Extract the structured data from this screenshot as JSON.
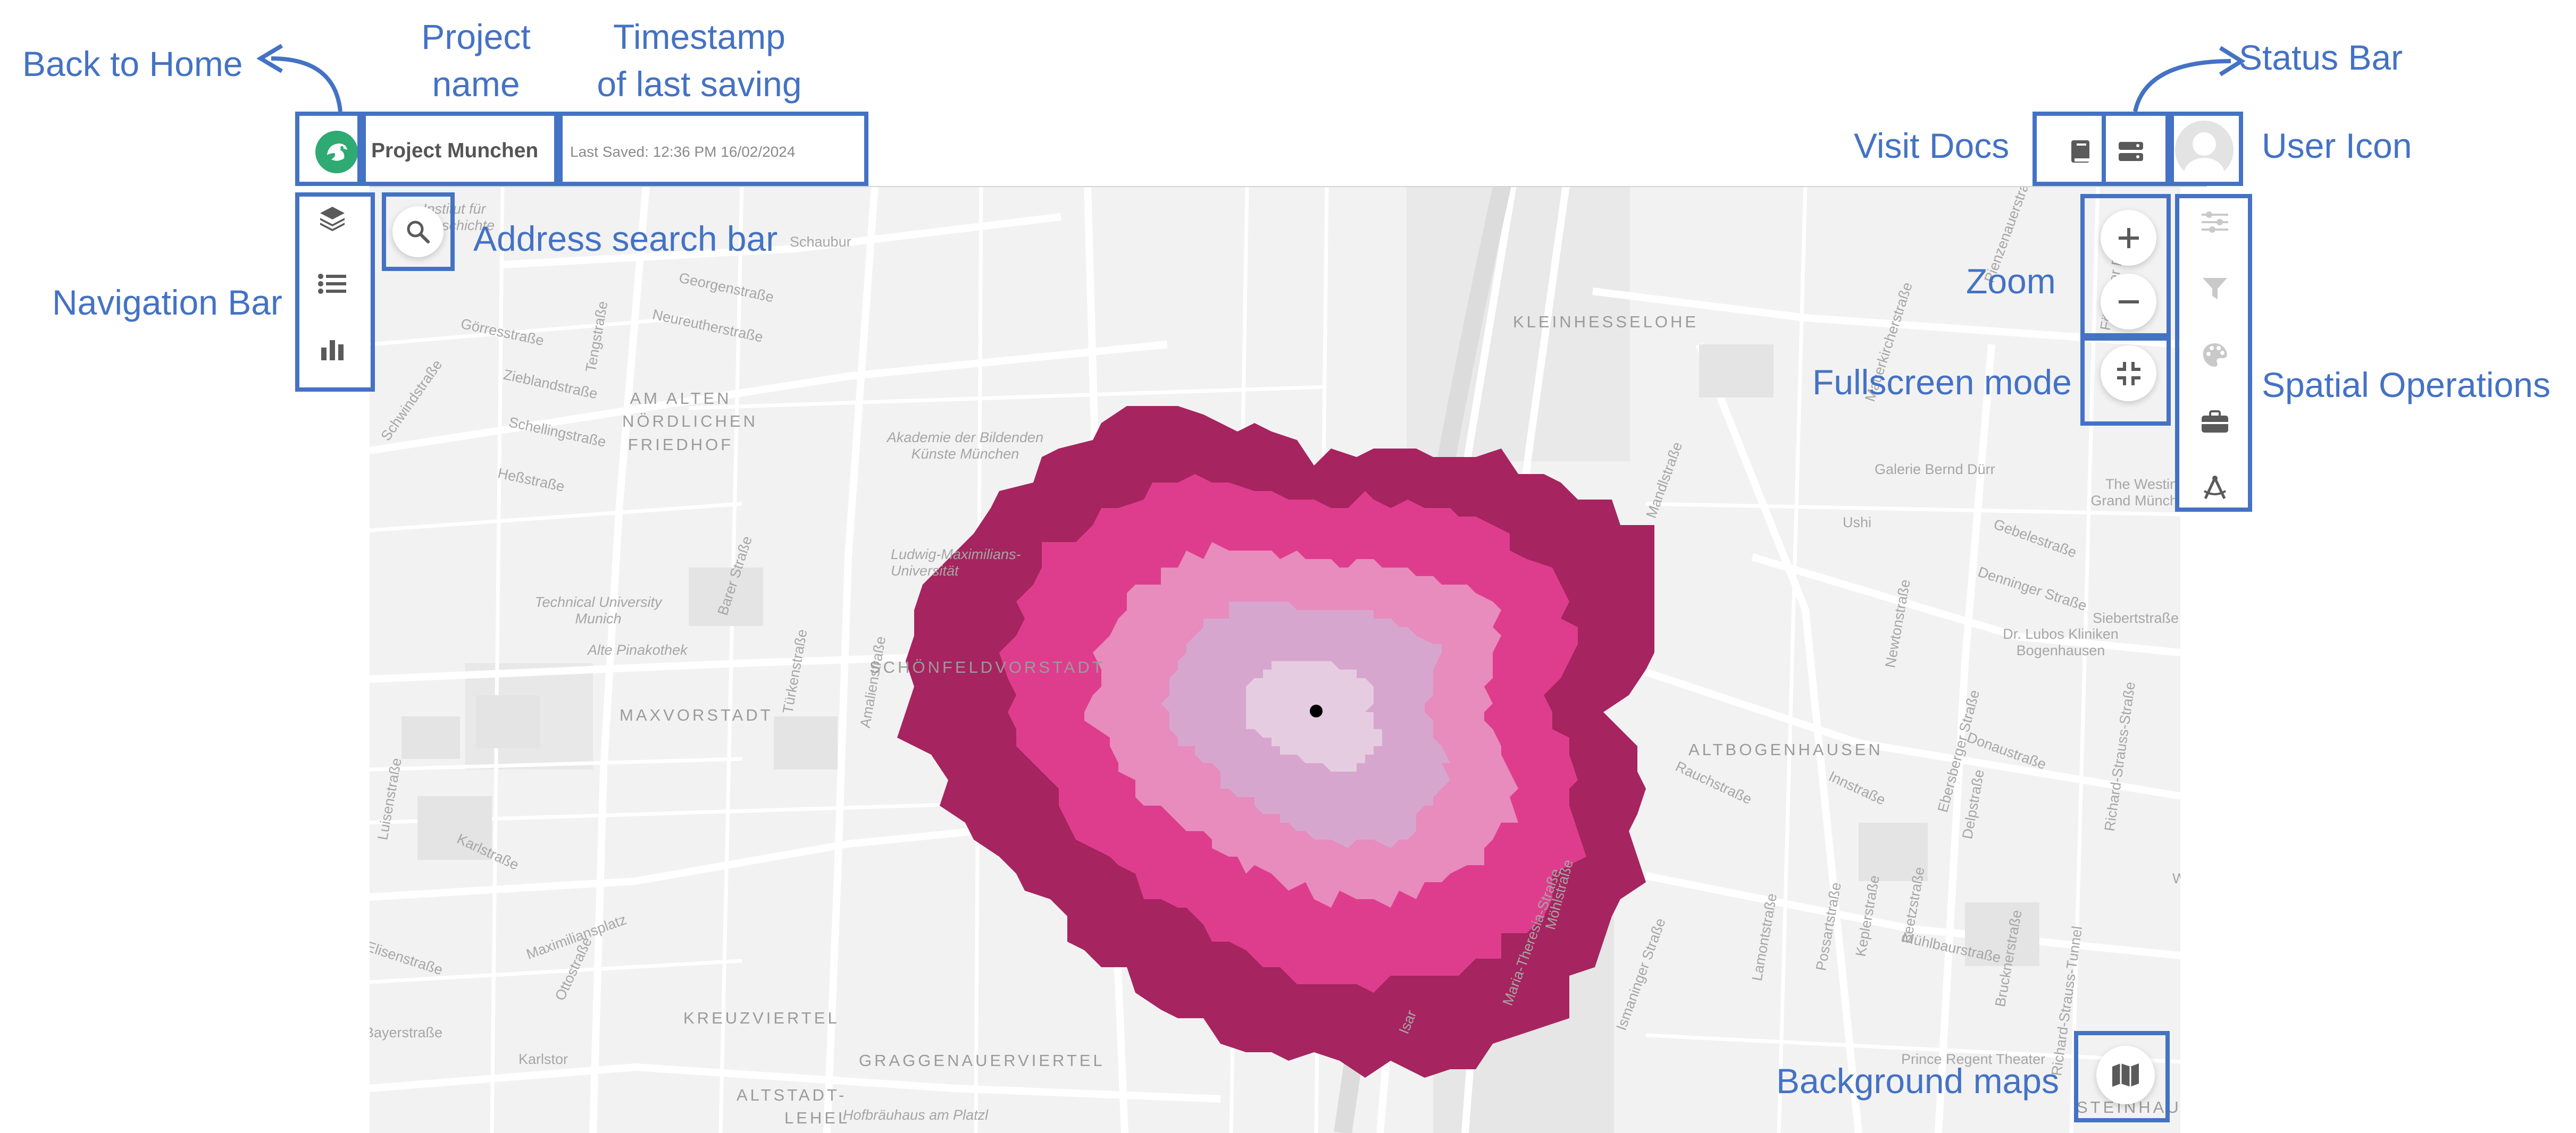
{
  "app": {
    "project_name": "Project Munchen",
    "last_saved": "Last Saved: 12:36 PM 16/02/2024"
  },
  "annotations": {
    "back_home": "Back to Home",
    "project_name_line1": "Project",
    "project_name_line2": "name",
    "timestamp_line1": "Timestamp",
    "timestamp_line2": "of last saving",
    "status_bar": "Status Bar",
    "visit_docs": "Visit Docs",
    "user_icon": "User Icon",
    "navigation_bar": "Navigation Bar",
    "address_search": "Address search bar",
    "zoom": "Zoom",
    "fullscreen": "Fullscreen mode",
    "spatial_operations": "Spatial Operations",
    "background_maps": "Background maps"
  },
  "map": {
    "streets": [
      "Schaubur",
      "Georgenstraße",
      "Neureutherstraße",
      "Görresstraße",
      "Tengstraße",
      "Zieblandstraße",
      "Schellingstraße",
      "Heßstraße",
      "Schwindstraße",
      "Barer Straße",
      "Türkenstraße",
      "Amalienstraße",
      "Luisenstraße",
      "Karlstraße",
      "Maximiliansplatz",
      "Elisenstraße",
      "Ottostraße",
      "Bayerstraße",
      "Karlstor",
      "Hofbräuhaus am Platzl",
      "Maria-Theresia-Straße",
      "Möhlstraße",
      "Ismaninger Straße",
      "Lamontstraße",
      "Possartstraße",
      "Keplerstraße",
      "Beetzstraße",
      "Mühlbaurstraße",
      "Brucknerstraße",
      "Richard-Strauss-Tunnel",
      "Richard-Strauss-Straße",
      "Rauchstraße",
      "Innstraße",
      "Ebersberger Straße",
      "Delpstraße",
      "Donaustraße",
      "Gebelestraße",
      "Denninger Straße",
      "Newtonstraße",
      "Siebertstraße",
      "Ushi",
      "Galerie Bernd Dürr",
      "The Westin Grand Münch",
      "Dr. Lubos Kliniken Bogenhausen",
      "Prince Regent Theater",
      "Mauerkircherstraße",
      "Föhringer Ring",
      "Akademie der Bildenden Künste München",
      "Technical University Munich",
      "Alte Pinakothek",
      "Ludwig-Maximilians-Universität",
      "Mandlstraße",
      "Institut für Geschichte",
      "Isar",
      "Pienzenauerstraße",
      "Wagmüllerstraße"
    ],
    "districts": [
      "AM ALTEN",
      "NÖRDLICHEN",
      "FRIEDHOF",
      "MAXVORSTADT",
      "SCHÖNFELDVORSTADT",
      "KLEINHESSELOHE",
      "ALTBOGENHAUSEN",
      "KREUZVIERTEL",
      "GRAGGENAUERVIERTEL",
      "ALTSTADT-",
      "LEHEL",
      "STEINHAUSEN"
    ]
  },
  "isochrone_colors": [
    "#a6245f",
    "#de3d8d",
    "#e88bbd",
    "#d7a6cf",
    "#e6cce0"
  ],
  "colors": {
    "accent": "#4472c4",
    "logo": "#2eaa72",
    "icon": "#5a5a5a",
    "icon_disabled": "#c9c9c9"
  },
  "icons": {
    "logo": "logo-icon",
    "docs": "book-icon",
    "status": "server-icon",
    "user": "user-avatar-icon",
    "layers": "layers-icon",
    "list": "list-icon",
    "chart": "bar-chart-icon",
    "search": "search-icon",
    "zoom_in": "plus-icon",
    "zoom_out": "minus-icon",
    "fullscreen": "fullscreen-exit-icon",
    "filter_settings": "sliders-icon",
    "filter": "filter-icon",
    "style": "palette-icon",
    "toolbox": "toolbox-icon",
    "draw": "compass-icon",
    "basemap": "map-icon"
  }
}
